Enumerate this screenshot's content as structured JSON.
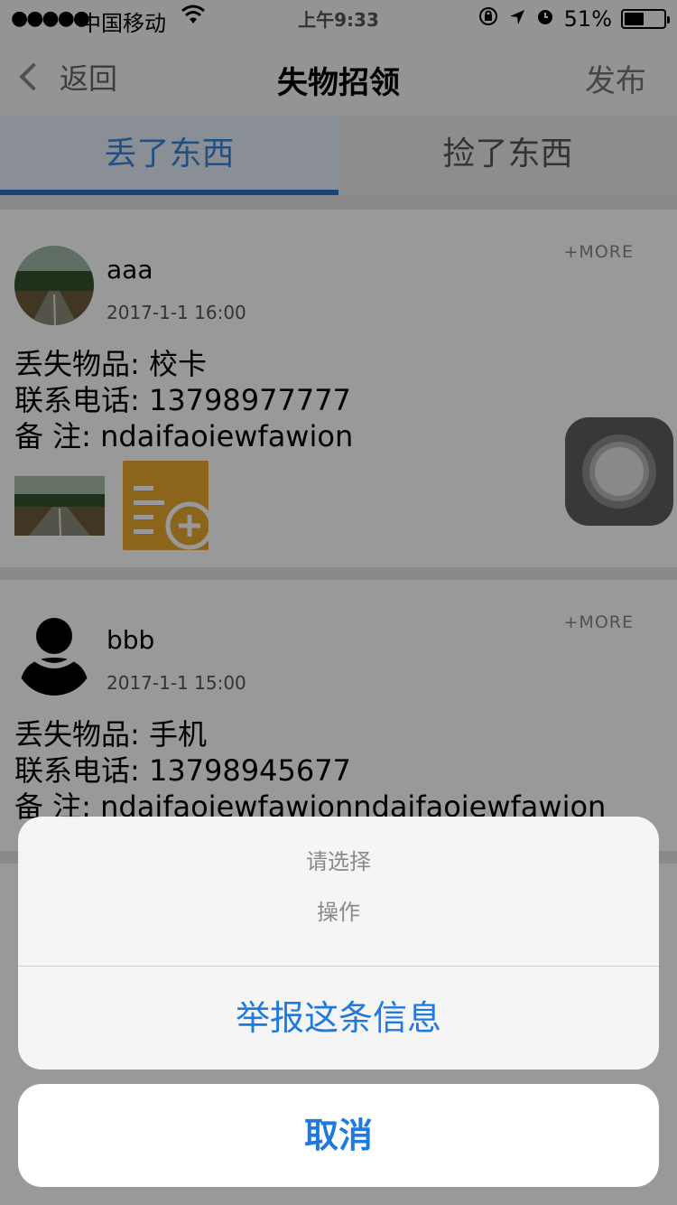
{
  "status_bar": {
    "signal": "●●●●●",
    "carrier": "中国移动",
    "time": "上午9:33",
    "battery_percent": "51%",
    "battery_level": 0.51
  },
  "nav": {
    "back_label": "返回",
    "title": "失物招领",
    "publish_label": "发布"
  },
  "tabs": [
    {
      "label": "丢了东西",
      "active": true
    },
    {
      "label": "捡了东西",
      "active": false
    }
  ],
  "posts": [
    {
      "username": "aaa",
      "time": "2017-1-1 16:00",
      "more": "+MORE",
      "item_line": "丢失物品: 校卡",
      "phone_line": "联系电话: 13798977777",
      "note_line": "备  注: ndaifaoiewfawion"
    },
    {
      "username": "bbb",
      "time": "2017-1-1 15:00",
      "more": "+MORE",
      "item_line": "丢失物品: 手机",
      "phone_line": "联系电话: 13798945677",
      "note_line": "备  注: ndaifaoiewfawionndaifaoiewfawion"
    }
  ],
  "action_sheet": {
    "title": "请选择",
    "message": "操作",
    "action_label": "举报这条信息",
    "cancel_label": "取消"
  },
  "colors": {
    "accent": "#1f7ae0",
    "tab_active": "#2a72c6",
    "add_button": "#e8a830"
  }
}
